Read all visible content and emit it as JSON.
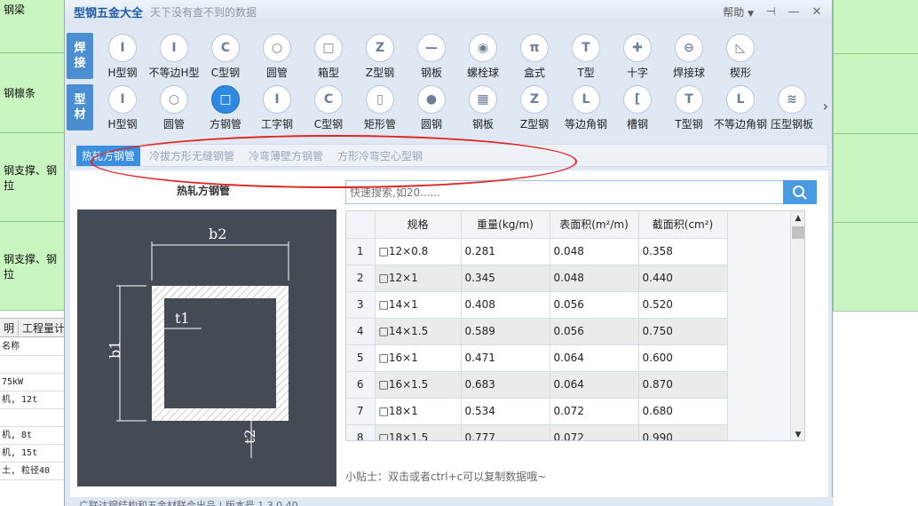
{
  "background": {
    "left_cells": [
      "钢梁",
      "钢檩条",
      "钢支撑、钢拉",
      "钢支撑、钢拉"
    ],
    "tabs": [
      "明",
      "工程量计"
    ],
    "rows": [
      "名称",
      "",
      "75kW",
      "机, 12t",
      "",
      "机, 8t",
      "机, 15t",
      "土, 粒径40"
    ]
  },
  "window": {
    "title": "型钢五金大全",
    "subtitle": "天下没有查不到的数据",
    "help": "帮助",
    "help_arrow": "▼",
    "pin": "⊣",
    "minimize": "—",
    "close": "✕"
  },
  "row1": {
    "label_top": "焊",
    "label_bottom": "接",
    "items": [
      {
        "label": "H型钢",
        "icon": "I",
        "icon_name": "h-beam-icon"
      },
      {
        "label": "不等边H型",
        "icon": "I",
        "icon_name": "unequal-h-beam-icon"
      },
      {
        "label": "C型钢",
        "icon": "C",
        "icon_name": "c-channel-icon"
      },
      {
        "label": "圆管",
        "icon": "○",
        "icon_name": "round-pipe-icon"
      },
      {
        "label": "箱型",
        "icon": "□",
        "icon_name": "box-section-icon"
      },
      {
        "label": "Z型钢",
        "icon": "Z",
        "icon_name": "z-steel-icon"
      },
      {
        "label": "钢板",
        "icon": "—",
        "icon_name": "steel-plate-icon"
      },
      {
        "label": "螺栓球",
        "icon": "◉",
        "icon_name": "bolt-ball-icon"
      },
      {
        "label": "盒式",
        "icon": "π",
        "icon_name": "box-type-icon"
      },
      {
        "label": "T型",
        "icon": "T",
        "icon_name": "t-section-icon"
      },
      {
        "label": "十字",
        "icon": "✚",
        "icon_name": "cross-section-icon"
      },
      {
        "label": "焊接球",
        "icon": "⊖",
        "icon_name": "welded-ball-icon"
      },
      {
        "label": "楔形",
        "icon": "◺",
        "icon_name": "wedge-icon"
      }
    ]
  },
  "row2": {
    "label_top": "型",
    "label_bottom": "材",
    "items": [
      {
        "label": "H型钢",
        "icon": "I",
        "icon_name": "h-beam-icon"
      },
      {
        "label": "圆管",
        "icon": "○",
        "icon_name": "round-pipe-icon"
      },
      {
        "label": "方钢管",
        "icon": "□",
        "icon_name": "square-tube-icon",
        "selected": true
      },
      {
        "label": "工字钢",
        "icon": "I",
        "icon_name": "i-beam-icon"
      },
      {
        "label": "C型钢",
        "icon": "C",
        "icon_name": "c-channel-icon"
      },
      {
        "label": "矩形管",
        "icon": "▯",
        "icon_name": "rect-tube-icon"
      },
      {
        "label": "圆钢",
        "icon": "●",
        "icon_name": "round-bar-icon"
      },
      {
        "label": "钢板",
        "icon": "▦",
        "icon_name": "steel-plate-icon"
      },
      {
        "label": "Z型钢",
        "icon": "Z",
        "icon_name": "z-steel-icon"
      },
      {
        "label": "等边角钢",
        "icon": "L",
        "icon_name": "equal-angle-icon"
      },
      {
        "label": "槽钢",
        "icon": "[",
        "icon_name": "channel-icon"
      },
      {
        "label": "T型钢",
        "icon": "T",
        "icon_name": "t-steel-icon"
      },
      {
        "label": "不等边角钢",
        "icon": "L",
        "icon_name": "unequal-angle-icon"
      },
      {
        "label": "压型钢板",
        "icon": "≋",
        "icon_name": "profiled-sheet-icon"
      }
    ],
    "more": "›"
  },
  "subtabs": [
    {
      "label": "热轧方钢管",
      "active": true
    },
    {
      "label": "冷拔方形无缝钢管"
    },
    {
      "label": "冷弯薄壁方钢管"
    },
    {
      "label": "方形冷弯空心型钢"
    }
  ],
  "section_title": "热轧方钢管",
  "diagram": {
    "b2": "b2",
    "b1": "b1",
    "t1": "t1",
    "t2": "t2"
  },
  "search": {
    "placeholder": "快速搜索,如20......"
  },
  "table": {
    "columns": [
      "规格",
      "重量(kg/m)",
      "表面积(m²/m)",
      "截面积(cm²)"
    ],
    "rows": [
      [
        "1",
        "□12×0.8",
        "0.281",
        "0.048",
        "0.358"
      ],
      [
        "2",
        "□12×1",
        "0.345",
        "0.048",
        "0.440"
      ],
      [
        "3",
        "□14×1",
        "0.408",
        "0.056",
        "0.520"
      ],
      [
        "4",
        "□14×1.5",
        "0.589",
        "0.056",
        "0.750"
      ],
      [
        "5",
        "□16×1",
        "0.471",
        "0.064",
        "0.600"
      ],
      [
        "6",
        "□16×1.5",
        "0.683",
        "0.064",
        "0.870"
      ],
      [
        "7",
        "□18×1",
        "0.534",
        "0.072",
        "0.680"
      ],
      [
        "8",
        "□18×1.5",
        "0.777",
        "0.072",
        "0.990"
      ]
    ]
  },
  "tip": "小贴士：双击或者ctrl+c可以复制数据哦~",
  "footer": "广联达钢结构和五金材联合出品 | 版本号 1.3.0.40"
}
